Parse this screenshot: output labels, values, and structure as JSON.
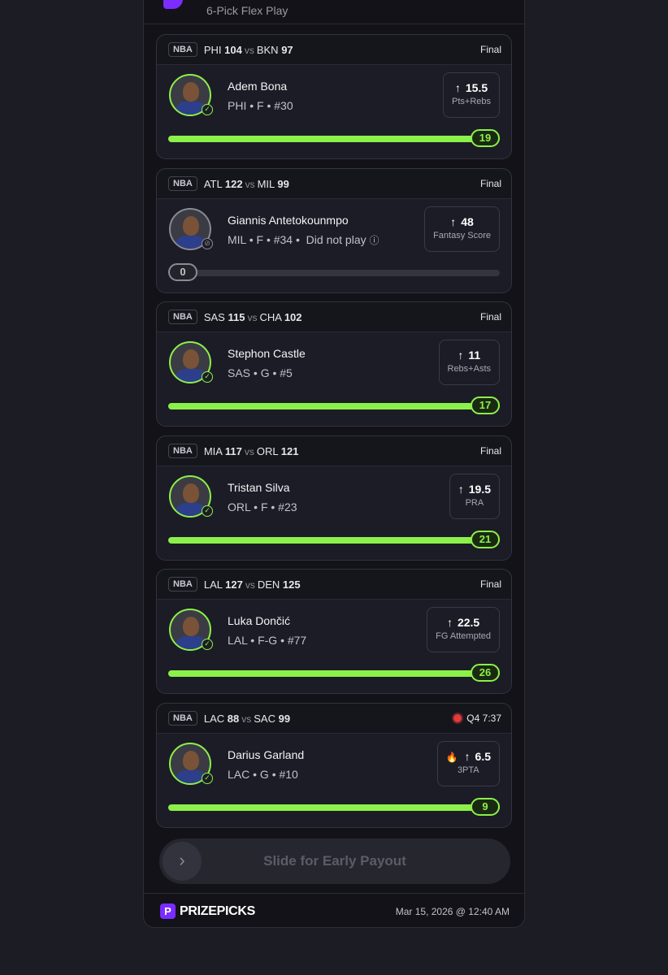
{
  "header": {
    "play_type": "6-Pick Flex Play"
  },
  "colors": {
    "accent_green": "#8cf04a",
    "brand_purple": "#7b2cff",
    "live_red": "#e23b3b"
  },
  "cards": [
    {
      "league": "NBA",
      "team1": "PHI",
      "score1": "104",
      "vs": "vs",
      "team2": "BKN",
      "score2": "97",
      "status": "Final",
      "live": false,
      "player": "Adem Bona",
      "meta": "PHI • F • #30",
      "line": "15.5",
      "stat": "Pts+Rebs",
      "actual": "19",
      "progress": 1.0,
      "dnp": false,
      "dnp_label": "",
      "flame": false
    },
    {
      "league": "NBA",
      "team1": "ATL",
      "score1": "122",
      "vs": "vs",
      "team2": "MIL",
      "score2": "99",
      "status": "Final",
      "live": false,
      "player": "Giannis Antetokounmpo",
      "meta": "MIL • F • #34 •",
      "line": "48",
      "stat": "Fantasy Score",
      "actual": "0",
      "progress": 0.0,
      "dnp": true,
      "dnp_label": "Did not play",
      "flame": false
    },
    {
      "league": "NBA",
      "team1": "SAS",
      "score1": "115",
      "vs": "vs",
      "team2": "CHA",
      "score2": "102",
      "status": "Final",
      "live": false,
      "player": "Stephon Castle",
      "meta": "SAS • G • #5",
      "line": "11",
      "stat": "Rebs+Asts",
      "actual": "17",
      "progress": 1.0,
      "dnp": false,
      "dnp_label": "",
      "flame": false
    },
    {
      "league": "NBA",
      "team1": "MIA",
      "score1": "117",
      "vs": "vs",
      "team2": "ORL",
      "score2": "121",
      "status": "Final",
      "live": false,
      "player": "Tristan Silva",
      "meta": "ORL • F • #23",
      "line": "19.5",
      "stat": "PRA",
      "actual": "21",
      "progress": 1.0,
      "dnp": false,
      "dnp_label": "",
      "flame": false
    },
    {
      "league": "NBA",
      "team1": "LAL",
      "score1": "127",
      "vs": "vs",
      "team2": "DEN",
      "score2": "125",
      "status": "Final",
      "live": false,
      "player": "Luka Dončić",
      "meta": "LAL • F-G • #77",
      "line": "22.5",
      "stat": "FG Attempted",
      "actual": "26",
      "progress": 1.0,
      "dnp": false,
      "dnp_label": "",
      "flame": false
    },
    {
      "league": "NBA",
      "team1": "LAC",
      "score1": "88",
      "vs": "vs",
      "team2": "SAC",
      "score2": "99",
      "status": "Q4 7:37",
      "live": true,
      "player": "Darius Garland",
      "meta": "LAC • G • #10",
      "line": "6.5",
      "stat": "3PTA",
      "actual": "9",
      "progress": 1.0,
      "dnp": false,
      "dnp_label": "",
      "flame": true
    }
  ],
  "slider": {
    "label": "Slide for Early Payout",
    "knob_icon": "chevron-right-icon"
  },
  "footer": {
    "brand": "PRIZEPICKS",
    "timestamp": "Mar 15, 2026 @ 12:40 AM"
  }
}
